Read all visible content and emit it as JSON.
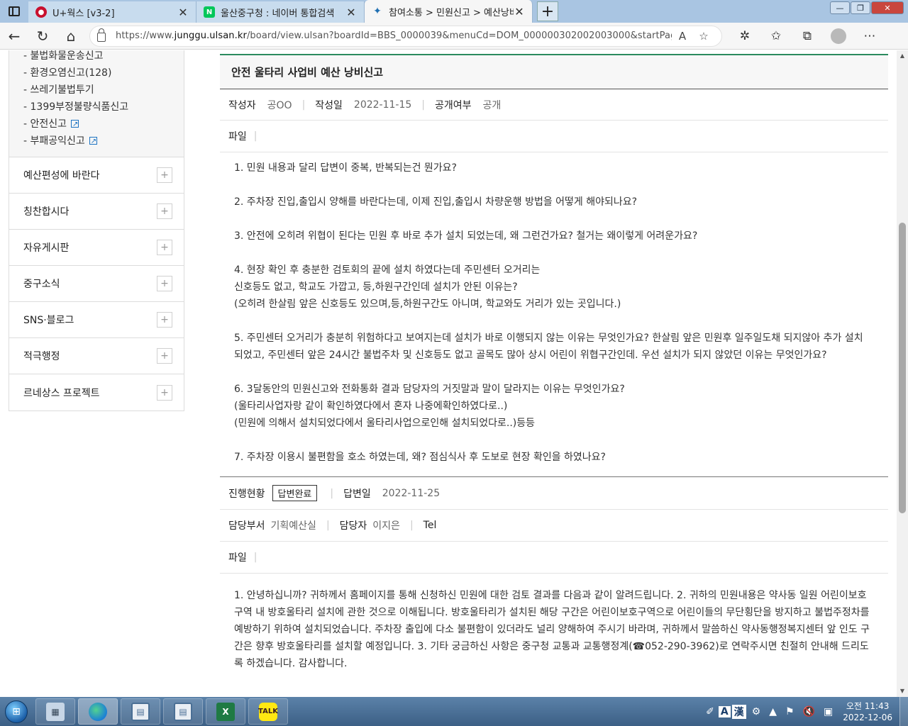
{
  "browser": {
    "tabs": [
      {
        "title": "U+웍스 [v3-2]",
        "icon": "lguplus-icon"
      },
      {
        "title": "울산중구청 : 네이버 통합검색",
        "icon": "naver-icon"
      },
      {
        "title": "참여소통 > 민원신고 > 예산낭비",
        "icon": "junggu-icon"
      }
    ],
    "url_prefix": "https://www.",
    "url_domain": "junggu.ulsan.kr",
    "url_rest": "/board/view.ulsan?boardId=BBS_0000039&menuCd=DOM_000000302002003000&startPage=..."
  },
  "sidebar": {
    "sub_items": [
      {
        "label": "- 불법화물운송신고",
        "external": false
      },
      {
        "label": "- 환경오염신고(128)",
        "external": false
      },
      {
        "label": "- 쓰레기불법투기",
        "external": false
      },
      {
        "label": "- 1399부정불량식품신고",
        "external": false
      },
      {
        "label": "- 안전신고",
        "external": true
      },
      {
        "label": "- 부패공익신고",
        "external": true
      }
    ],
    "menu": [
      {
        "label": "예산편성에 바란다"
      },
      {
        "label": "칭찬합시다"
      },
      {
        "label": "자유게시판"
      },
      {
        "label": "중구소식"
      },
      {
        "label": "SNS·블로그"
      },
      {
        "label": "적극행정"
      },
      {
        "label": "르네상스 프로젝트"
      }
    ]
  },
  "post": {
    "title": "안전 울타리 사업비 예산 낭비신고",
    "author_label": "작성자",
    "author": "공OO",
    "date_label": "작성일",
    "date": "2022-11-15",
    "public_label": "공개여부",
    "public": "공개",
    "file_label": "파일",
    "body": [
      "1. 민원 내용과 달리 답변이 중복, 반복되는건 뭔가요?",
      "",
      "2. 주차장 진입,출입시 양해를 바란다는데, 이제 진입,출입시 차량운행 방법을 어떻게 해야되나요?",
      "",
      "3. 안전에 오히려 위협이 된다는 민원 후 바로 추가 설치 되었는데, 왜 그런건가요? 철거는 왜이렇게 어려운가요?",
      "",
      "4. 현장 확인 후 충분한 검토회의 끝에 설치 하였다는데 주민센터 오거리는",
      "신호등도 없고, 학교도 가깝고, 등,하원구간인데 설치가 안된 이유는?",
      "(오히려 한살림 앞은 신호등도 있으며,등,하원구간도 아니며, 학교와도 거리가 있는 곳입니다.)",
      "",
      "5. 주민센터 오거리가 충분히 위험하다고 보여지는데 설치가 바로 이행되지 않는 이유는 무엇인가요? 한살림 앞은 민원후 일주일도채 되지않아 추가 설치 되었고, 주민센터 앞은 24시간 불법주차 및 신호등도 없고 골목도 많아 상시 어린이 위협구간인데. 우선 설치가 되지 않았던 이유는 무엇인가요?",
      "",
      "6. 3달동안의 민원신고와 전화통화 결과 담당자의 거짓말과 말이 달라지는 이유는 무엇인가요?",
      "(울타리사업자랑 같이 확인하였다에서 혼자 나중에확인하였다로..)",
      "(민원에 의해서 설치되었다에서 울타리사업으로인해 설치되었다로..)등등",
      "",
      "7. 주차장 이용시 불편함을 호소 하였는데, 왜? 점심식사 후 도보로 현장 확인을 하였나요?"
    ]
  },
  "answer": {
    "status_label": "진행현황",
    "status": "답변완료",
    "date_label": "답변일",
    "date": "2022-11-25",
    "dept_label": "담당부서",
    "dept": "기획예산실",
    "manager_label": "담당자",
    "manager": "이지은",
    "tel_label": "Tel",
    "file_label": "파일",
    "text": "1. 안녕하십니까? 귀하께서 홈페이지를 통해 신청하신 민원에 대한 검토 결과를 다음과 같이 알려드립니다. 2. 귀하의 민원내용은 약사동 일원 어린이보호구역 내 방호울타리 설치에 관한 것으로 이해됩니다. 방호울타리가 설치된 해당 구간은 어린이보호구역으로 어린이들의 무단횡단을 방지하고 불법주정차를 예방하기 위하여 설치되었습니다. 주차장 출입에 다소 불편함이 있더라도 널리 양해하여 주시기 바라며, 귀하께서 말씀하신 약사동행정복지센터 앞 인도 구간은 향후 방호울타리를 설치할 예정입니다. 3. 기타 궁금하신 사항은 중구청 교통과 교통행정계(☎052-290-3962)로 연락주시면 친절히 안내해 드리도록 하겠습니다. 감사합니다."
  },
  "taskbar": {
    "ime": "A",
    "ime2": "漢",
    "time": "오전 11:43",
    "date": "2022-12-06",
    "apps": [
      "calculator-icon",
      "edge-icon",
      "window-icon",
      "window-icon",
      "excel-icon",
      "kakaotalk-icon"
    ],
    "talk_label": "TALK"
  }
}
